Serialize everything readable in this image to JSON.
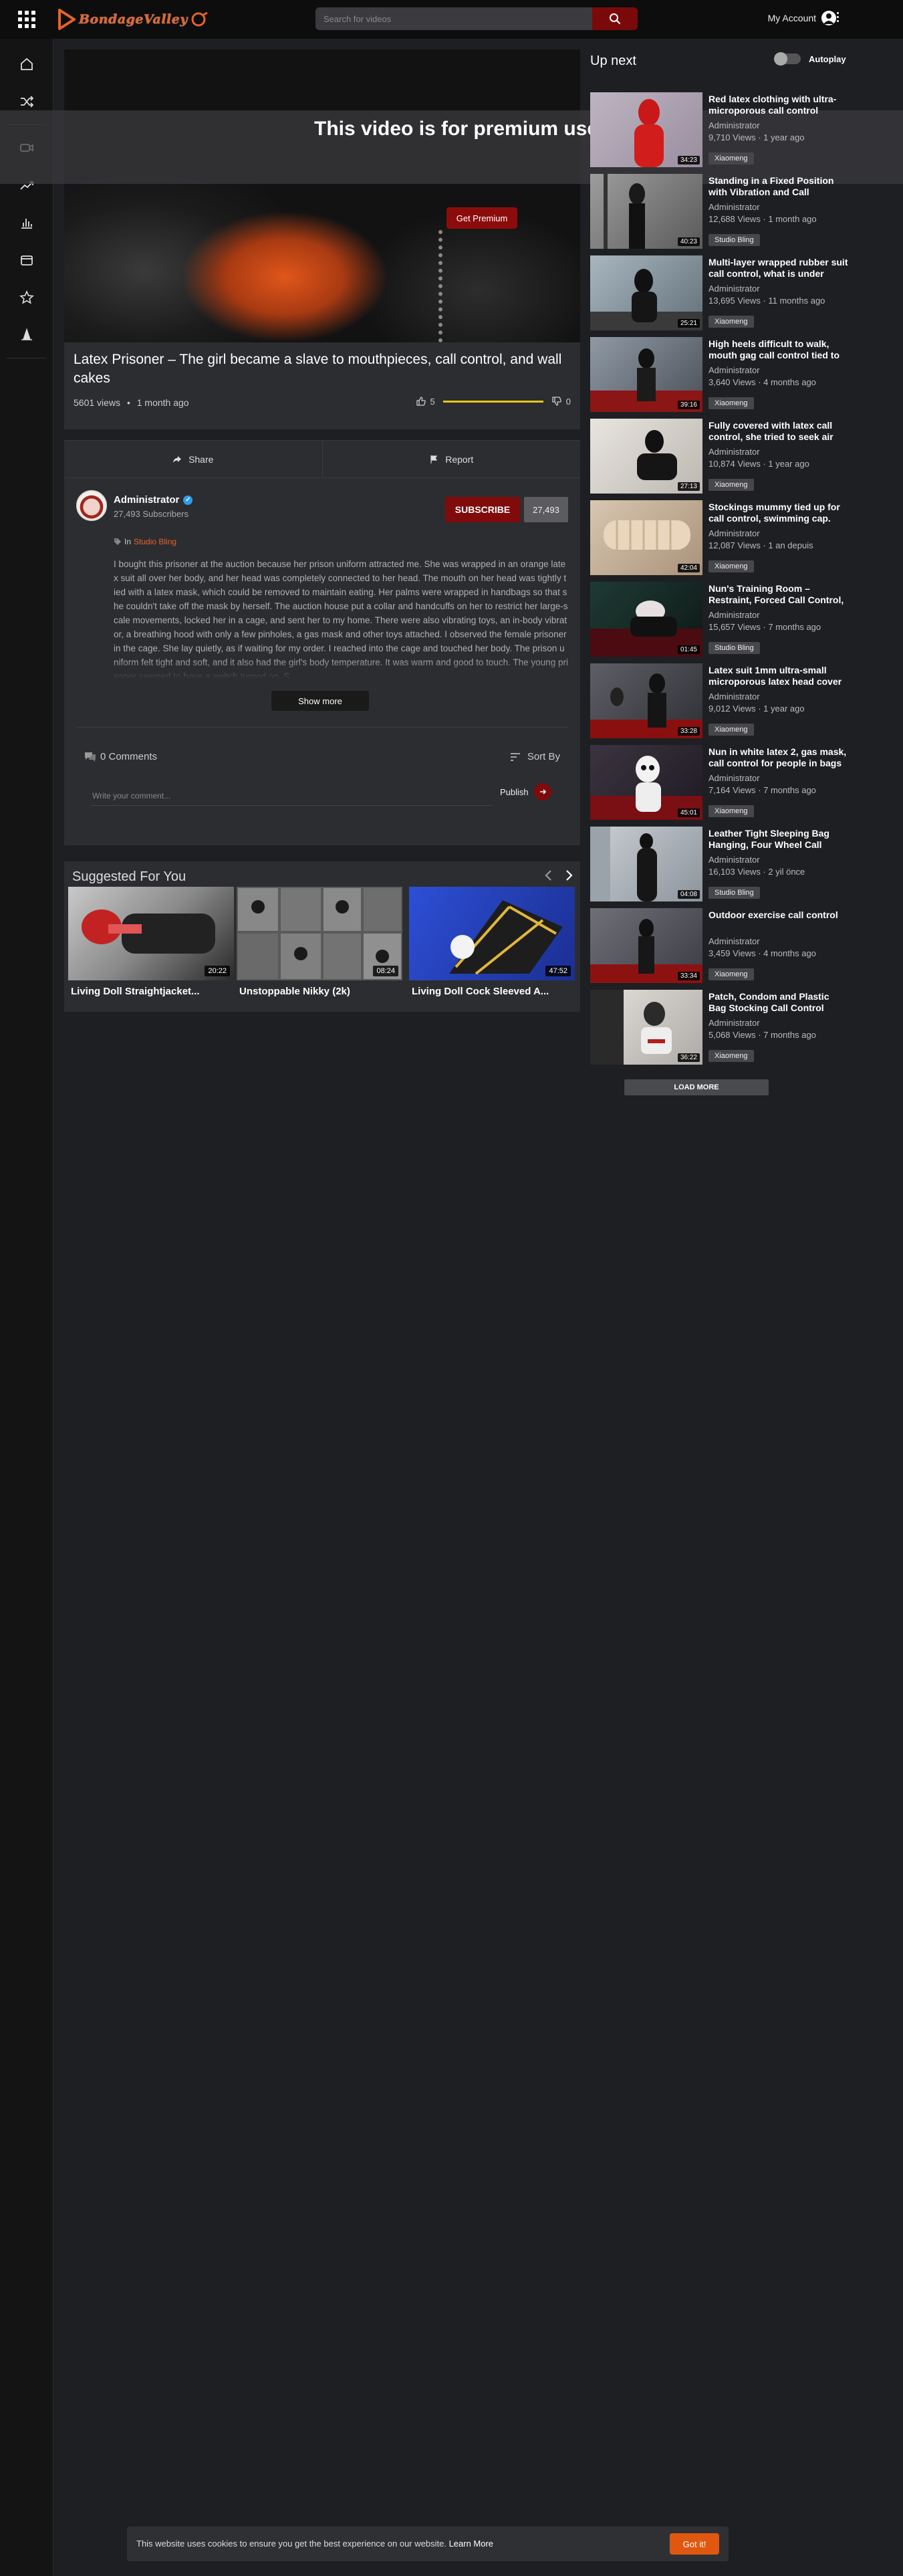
{
  "header": {
    "logo_text": "BondageValley",
    "search_placeholder": "Search for videos",
    "account_label": "My Account"
  },
  "player": {
    "premium_message": "This video is for premium user",
    "premium_button": "Get Premium"
  },
  "video": {
    "title": "Latex Prisoner – The girl became a slave to mouthpieces, call control, and wall cakes",
    "views": "5601 views",
    "age": "1 month ago",
    "likes": "5",
    "dislikes": "0",
    "like_ratio": 1.0
  },
  "actions": {
    "share": "Share",
    "report": "Report"
  },
  "channel": {
    "name": "Administrator",
    "subscribers": "27,493 Subscribers",
    "subscribe_label": "SUBSCRIBE",
    "subscribe_count": "27,493",
    "category_prefix": "In",
    "category": "Studio Bling",
    "description": "I bought this prisoner at the auction because her prison uniform attracted me. She was wrapped in an orange latex suit all over her body, and her head was completely connected to her head. The mouth on her head was tightly tied with a latex mask, which could be removed to maintain eating. Her palms were wrapped in handbags so that she couldn't take off the mask by herself. The auction house put a collar and handcuffs on her to restrict her large-scale movements, locked her in a cage, and sent her to my home. There were also vibrating toys, an in-body vibrator, a breathing hood with only a few pinholes, a gas mask and other toys attached. I observed the female prisoner in the cage. She lay quietly, as if waiting for my order. I reached into the cage and touched her body. The prison uniform felt tight and soft, and it also had the girl's body temperature. It was warm and good to touch. The young prisoner seemed to have a switch turned on. S",
    "show_more": "Show more"
  },
  "comments": {
    "count_label": "0 Comments",
    "sort_label": "Sort By",
    "input_placeholder": "Write your comment...",
    "publish": "Publish"
  },
  "suggested": {
    "heading": "Suggested For You",
    "items": [
      {
        "title": "Living Doll Straightjacket...",
        "duration": "20:22"
      },
      {
        "title": "Unstoppable Nikky (2k)",
        "duration": "08:24"
      },
      {
        "title": "Living Doll Cock Sleeved A...",
        "duration": "47:52"
      }
    ]
  },
  "upnext": {
    "heading": "Up next",
    "autoplay_label": "Autoplay",
    "items": [
      {
        "title": "Red latex clothing with ultra-microporous call control",
        "author": "Administrator",
        "views": "9,710 Views · 1 year ago",
        "tag": "Xiaomeng",
        "duration": "34:23"
      },
      {
        "title": "Standing in a Fixed Position with Vibration and Call",
        "author": "Administrator",
        "views": "12,688 Views · 1 month ago",
        "tag": "Studio Bling",
        "duration": "40:23"
      },
      {
        "title": "Multi-layer wrapped rubber suit call control, what is under",
        "author": "Administrator",
        "views": "13,695 Views · 11 months ago",
        "tag": "Xiaomeng",
        "duration": "25:21"
      },
      {
        "title": "High heels difficult to walk, mouth gag call control tied to",
        "author": "Administrator",
        "views": "3,640 Views · 4 months ago",
        "tag": "Xiaomeng",
        "duration": "39:16"
      },
      {
        "title": "Fully covered with latex call control, she tried to seek air",
        "author": "Administrator",
        "views": "10,874 Views · 1 year ago",
        "tag": "Xiaomeng",
        "duration": "27:13"
      },
      {
        "title": "Stockings mummy tied up for call control, swimming cap.",
        "author": "Administrator",
        "views": "12,087 Views · 1 an depuis",
        "tag": "Xiaomeng",
        "duration": "42:04"
      },
      {
        "title": "Nun's Training Room – Restraint, Forced Call Control,",
        "author": "Administrator",
        "views": "15,657 Views · 7 months ago",
        "tag": "Studio Bling",
        "duration": "01:45"
      },
      {
        "title": "Latex suit 1mm ultra-small microporous latex head cover",
        "author": "Administrator",
        "views": "9,012 Views · 1 year ago",
        "tag": "Xiaomeng",
        "duration": "33:28"
      },
      {
        "title": "Nun in white latex 2, gas mask, call control for people in bags",
        "author": "Administrator",
        "views": "7,164 Views · 7 months ago",
        "tag": "Xiaomeng",
        "duration": "45:01"
      },
      {
        "title": "Leather Tight Sleeping Bag Hanging, Four Wheel Call",
        "author": "Administrator",
        "views": "16,103 Views · 2 yil önce",
        "tag": "Studio Bling",
        "duration": "04:08"
      },
      {
        "title": "Outdoor exercise call control",
        "author": "Administrator",
        "views": "3,459 Views · 4 months ago",
        "tag": "Xiaomeng",
        "duration": "33:34"
      },
      {
        "title": "Patch, Condom and Plastic Bag Stocking Call Control",
        "author": "Administrator",
        "views": "5,068 Views · 7 months ago",
        "tag": "Xiaomeng",
        "duration": "36:22"
      }
    ],
    "load_more": "LOAD MORE"
  },
  "cookie": {
    "text": "This website uses cookies to ensure you get the best experience on our website.",
    "learn_more": "Learn More",
    "button": "Got it!"
  },
  "colors": {
    "accent_red": "#7f0b0b",
    "brand_orange": "#e8622a",
    "like_bar": "#e8c51a",
    "cookie_button": "#e0580f"
  }
}
